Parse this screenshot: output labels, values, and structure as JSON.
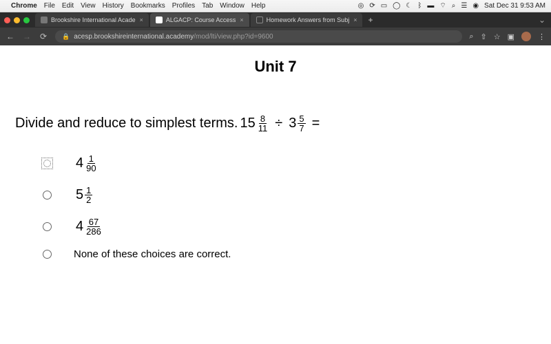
{
  "mac_menu": {
    "app": "Chrome",
    "items": [
      "File",
      "Edit",
      "View",
      "History",
      "Bookmarks",
      "Profiles",
      "Tab",
      "Window",
      "Help"
    ],
    "clock": "Sat Dec 31 9:53 AM"
  },
  "tabs": [
    {
      "label": "Brookshire International Acade"
    },
    {
      "label": "ALGACP: Course Access"
    },
    {
      "label": "Homework Answers from Subj"
    }
  ],
  "toolbar": {
    "url_host": "acesp.brookshireinternational.academy",
    "url_path": "/mod/lti/view.php?id=9600"
  },
  "page": {
    "unit_title": "Unit 7",
    "question_prefix": "Divide and reduce to simplest terms.  ",
    "expr": {
      "a_whole": "15",
      "a_num": "8",
      "a_den": "11",
      "op": "÷",
      "b_whole": "3",
      "b_num": "5",
      "b_den": "7",
      "eq": "="
    },
    "choices": [
      {
        "whole": "4",
        "num": "1",
        "den": "90",
        "selected": true
      },
      {
        "whole": "5",
        "num": "1",
        "den": "2",
        "selected": false
      },
      {
        "whole": "4",
        "num": "67",
        "den": "286",
        "selected": false
      },
      {
        "text": "None of these choices are correct.",
        "selected": false
      }
    ]
  }
}
